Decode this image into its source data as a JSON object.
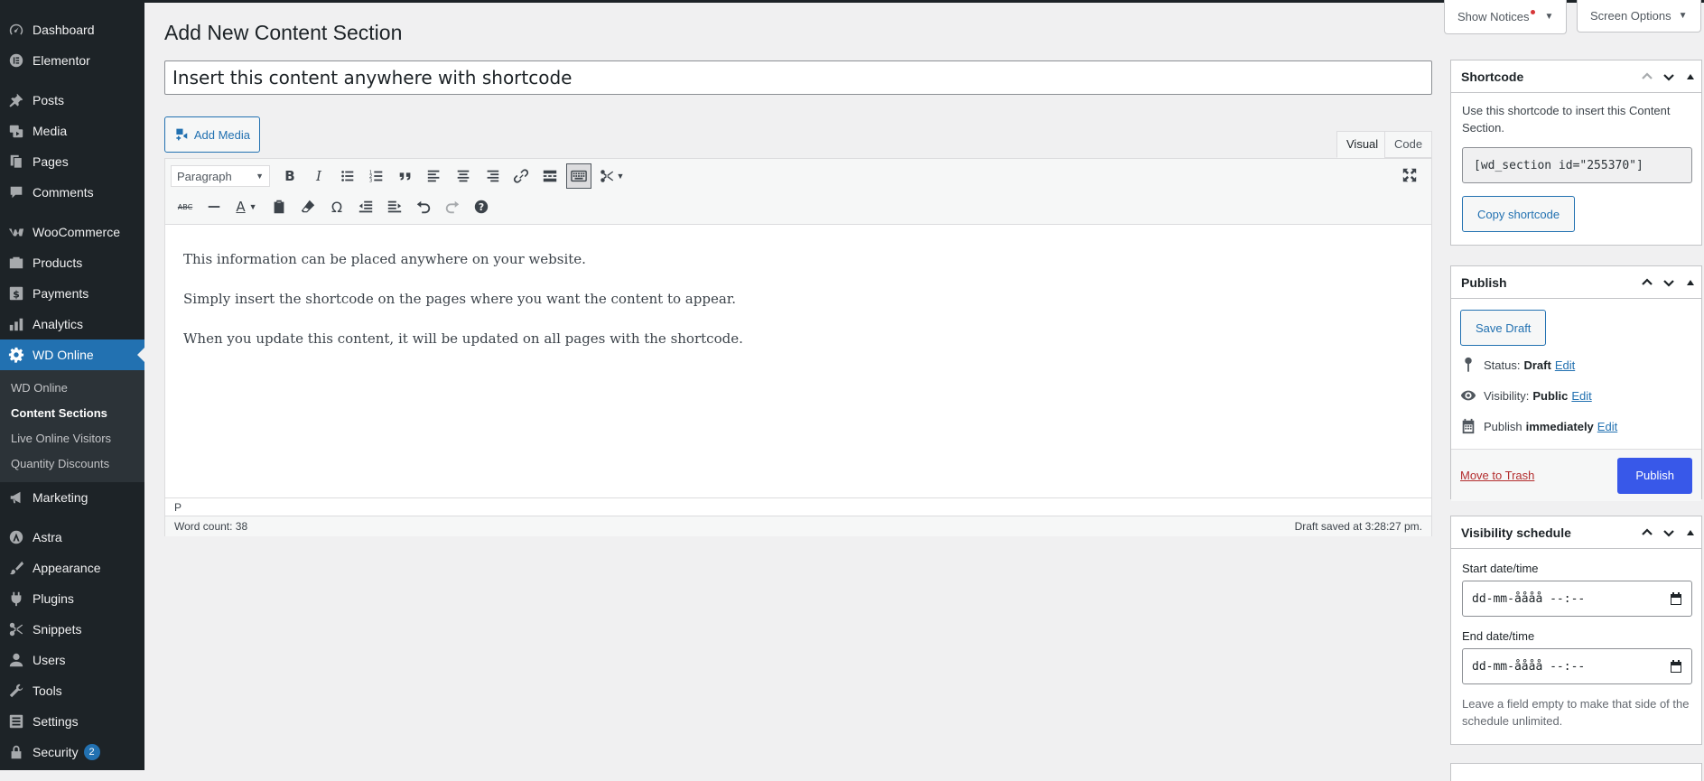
{
  "sidebar": {
    "items": [
      {
        "label": "Dashboard",
        "icon": "dashboard-icon"
      },
      {
        "label": "Elementor",
        "icon": "elementor-icon"
      },
      {
        "label": "Posts",
        "icon": "pin-icon"
      },
      {
        "label": "Media",
        "icon": "media-icon"
      },
      {
        "label": "Pages",
        "icon": "pages-icon"
      },
      {
        "label": "Comments",
        "icon": "comments-icon"
      },
      {
        "label": "WooCommerce",
        "icon": "woocommerce-icon"
      },
      {
        "label": "Products",
        "icon": "products-icon"
      },
      {
        "label": "Payments",
        "icon": "payments-icon"
      },
      {
        "label": "Analytics",
        "icon": "analytics-icon"
      },
      {
        "label": "WD Online",
        "icon": "gear-icon"
      },
      {
        "label": "Marketing",
        "icon": "megaphone-icon"
      },
      {
        "label": "Astra",
        "icon": "astra-icon"
      },
      {
        "label": "Appearance",
        "icon": "brush-icon"
      },
      {
        "label": "Plugins",
        "icon": "plugin-icon"
      },
      {
        "label": "Snippets",
        "icon": "scissors-icon"
      },
      {
        "label": "Users",
        "icon": "user-icon"
      },
      {
        "label": "Tools",
        "icon": "wrench-icon"
      },
      {
        "label": "Settings",
        "icon": "settings-icon"
      },
      {
        "label": "Security",
        "icon": "lock-icon",
        "badge": "2"
      }
    ],
    "submenu": [
      "WD Online",
      "Content Sections",
      "Live Online Visitors",
      "Quantity Discounts"
    ]
  },
  "screen": {
    "notices": "Show Notices",
    "options": "Screen Options"
  },
  "page": {
    "title": "Add New Content Section",
    "post_title": "Insert this content anywhere with shortcode"
  },
  "editor": {
    "add_media": "Add Media",
    "tab_visual": "Visual",
    "tab_code": "Code",
    "format": "Paragraph",
    "paragraphs": [
      "This information can be placed anywhere on your website.",
      "Simply insert the shortcode on the pages where you want the content to appear.",
      "When you update this content, it will be updated on all pages with the shortcode."
    ],
    "path": "P",
    "word_count": "Word count: 38",
    "draft_saved": "Draft saved at 3:28:27 pm."
  },
  "shortcode_box": {
    "title": "Shortcode",
    "description": "Use this shortcode to insert this Content Section.",
    "shortcode": "[wd_section id=\"255370\"]",
    "copy_label": "Copy shortcode"
  },
  "publish_box": {
    "title": "Publish",
    "save_draft": "Save Draft",
    "status_label": "Status:",
    "status_value": "Draft",
    "visibility_label": "Visibility:",
    "visibility_value": "Public",
    "publish_label": "Publish",
    "publish_value": "immediately",
    "edit": "Edit",
    "trash": "Move to Trash",
    "publish_button": "Publish"
  },
  "schedule_box": {
    "title": "Visibility schedule",
    "start_label": "Start date/time",
    "end_label": "End date/time",
    "date_placeholder": "dd-mm-åååå --:--",
    "help": "Leave a field empty to make that side of the schedule unlimited."
  },
  "colors": {
    "sidebar_bg": "#1d2327",
    "accent": "#2271b1",
    "publish_button": "#3858e9",
    "trash": "#b32d2e"
  }
}
